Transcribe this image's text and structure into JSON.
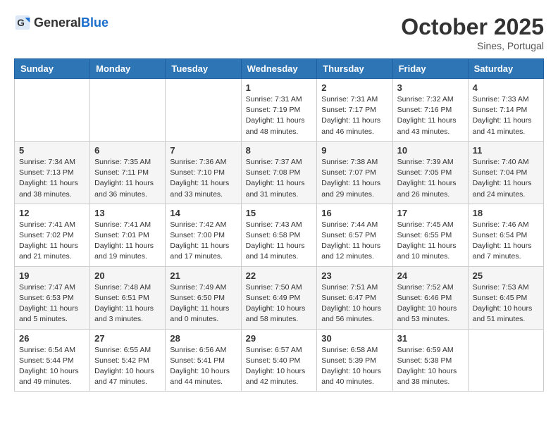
{
  "header": {
    "logo_general": "General",
    "logo_blue": "Blue",
    "month": "October 2025",
    "location": "Sines, Portugal"
  },
  "days_of_week": [
    "Sunday",
    "Monday",
    "Tuesday",
    "Wednesday",
    "Thursday",
    "Friday",
    "Saturday"
  ],
  "weeks": [
    [
      {
        "day": "",
        "info": ""
      },
      {
        "day": "",
        "info": ""
      },
      {
        "day": "",
        "info": ""
      },
      {
        "day": "1",
        "info": "Sunrise: 7:31 AM\nSunset: 7:19 PM\nDaylight: 11 hours\nand 48 minutes."
      },
      {
        "day": "2",
        "info": "Sunrise: 7:31 AM\nSunset: 7:17 PM\nDaylight: 11 hours\nand 46 minutes."
      },
      {
        "day": "3",
        "info": "Sunrise: 7:32 AM\nSunset: 7:16 PM\nDaylight: 11 hours\nand 43 minutes."
      },
      {
        "day": "4",
        "info": "Sunrise: 7:33 AM\nSunset: 7:14 PM\nDaylight: 11 hours\nand 41 minutes."
      }
    ],
    [
      {
        "day": "5",
        "info": "Sunrise: 7:34 AM\nSunset: 7:13 PM\nDaylight: 11 hours\nand 38 minutes."
      },
      {
        "day": "6",
        "info": "Sunrise: 7:35 AM\nSunset: 7:11 PM\nDaylight: 11 hours\nand 36 minutes."
      },
      {
        "day": "7",
        "info": "Sunrise: 7:36 AM\nSunset: 7:10 PM\nDaylight: 11 hours\nand 33 minutes."
      },
      {
        "day": "8",
        "info": "Sunrise: 7:37 AM\nSunset: 7:08 PM\nDaylight: 11 hours\nand 31 minutes."
      },
      {
        "day": "9",
        "info": "Sunrise: 7:38 AM\nSunset: 7:07 PM\nDaylight: 11 hours\nand 29 minutes."
      },
      {
        "day": "10",
        "info": "Sunrise: 7:39 AM\nSunset: 7:05 PM\nDaylight: 11 hours\nand 26 minutes."
      },
      {
        "day": "11",
        "info": "Sunrise: 7:40 AM\nSunset: 7:04 PM\nDaylight: 11 hours\nand 24 minutes."
      }
    ],
    [
      {
        "day": "12",
        "info": "Sunrise: 7:41 AM\nSunset: 7:02 PM\nDaylight: 11 hours\nand 21 minutes."
      },
      {
        "day": "13",
        "info": "Sunrise: 7:41 AM\nSunset: 7:01 PM\nDaylight: 11 hours\nand 19 minutes."
      },
      {
        "day": "14",
        "info": "Sunrise: 7:42 AM\nSunset: 7:00 PM\nDaylight: 11 hours\nand 17 minutes."
      },
      {
        "day": "15",
        "info": "Sunrise: 7:43 AM\nSunset: 6:58 PM\nDaylight: 11 hours\nand 14 minutes."
      },
      {
        "day": "16",
        "info": "Sunrise: 7:44 AM\nSunset: 6:57 PM\nDaylight: 11 hours\nand 12 minutes."
      },
      {
        "day": "17",
        "info": "Sunrise: 7:45 AM\nSunset: 6:55 PM\nDaylight: 11 hours\nand 10 minutes."
      },
      {
        "day": "18",
        "info": "Sunrise: 7:46 AM\nSunset: 6:54 PM\nDaylight: 11 hours\nand 7 minutes."
      }
    ],
    [
      {
        "day": "19",
        "info": "Sunrise: 7:47 AM\nSunset: 6:53 PM\nDaylight: 11 hours\nand 5 minutes."
      },
      {
        "day": "20",
        "info": "Sunrise: 7:48 AM\nSunset: 6:51 PM\nDaylight: 11 hours\nand 3 minutes."
      },
      {
        "day": "21",
        "info": "Sunrise: 7:49 AM\nSunset: 6:50 PM\nDaylight: 11 hours\nand 0 minutes."
      },
      {
        "day": "22",
        "info": "Sunrise: 7:50 AM\nSunset: 6:49 PM\nDaylight: 10 hours\nand 58 minutes."
      },
      {
        "day": "23",
        "info": "Sunrise: 7:51 AM\nSunset: 6:47 PM\nDaylight: 10 hours\nand 56 minutes."
      },
      {
        "day": "24",
        "info": "Sunrise: 7:52 AM\nSunset: 6:46 PM\nDaylight: 10 hours\nand 53 minutes."
      },
      {
        "day": "25",
        "info": "Sunrise: 7:53 AM\nSunset: 6:45 PM\nDaylight: 10 hours\nand 51 minutes."
      }
    ],
    [
      {
        "day": "26",
        "info": "Sunrise: 6:54 AM\nSunset: 5:44 PM\nDaylight: 10 hours\nand 49 minutes."
      },
      {
        "day": "27",
        "info": "Sunrise: 6:55 AM\nSunset: 5:42 PM\nDaylight: 10 hours\nand 47 minutes."
      },
      {
        "day": "28",
        "info": "Sunrise: 6:56 AM\nSunset: 5:41 PM\nDaylight: 10 hours\nand 44 minutes."
      },
      {
        "day": "29",
        "info": "Sunrise: 6:57 AM\nSunset: 5:40 PM\nDaylight: 10 hours\nand 42 minutes."
      },
      {
        "day": "30",
        "info": "Sunrise: 6:58 AM\nSunset: 5:39 PM\nDaylight: 10 hours\nand 40 minutes."
      },
      {
        "day": "31",
        "info": "Sunrise: 6:59 AM\nSunset: 5:38 PM\nDaylight: 10 hours\nand 38 minutes."
      },
      {
        "day": "",
        "info": ""
      }
    ]
  ]
}
